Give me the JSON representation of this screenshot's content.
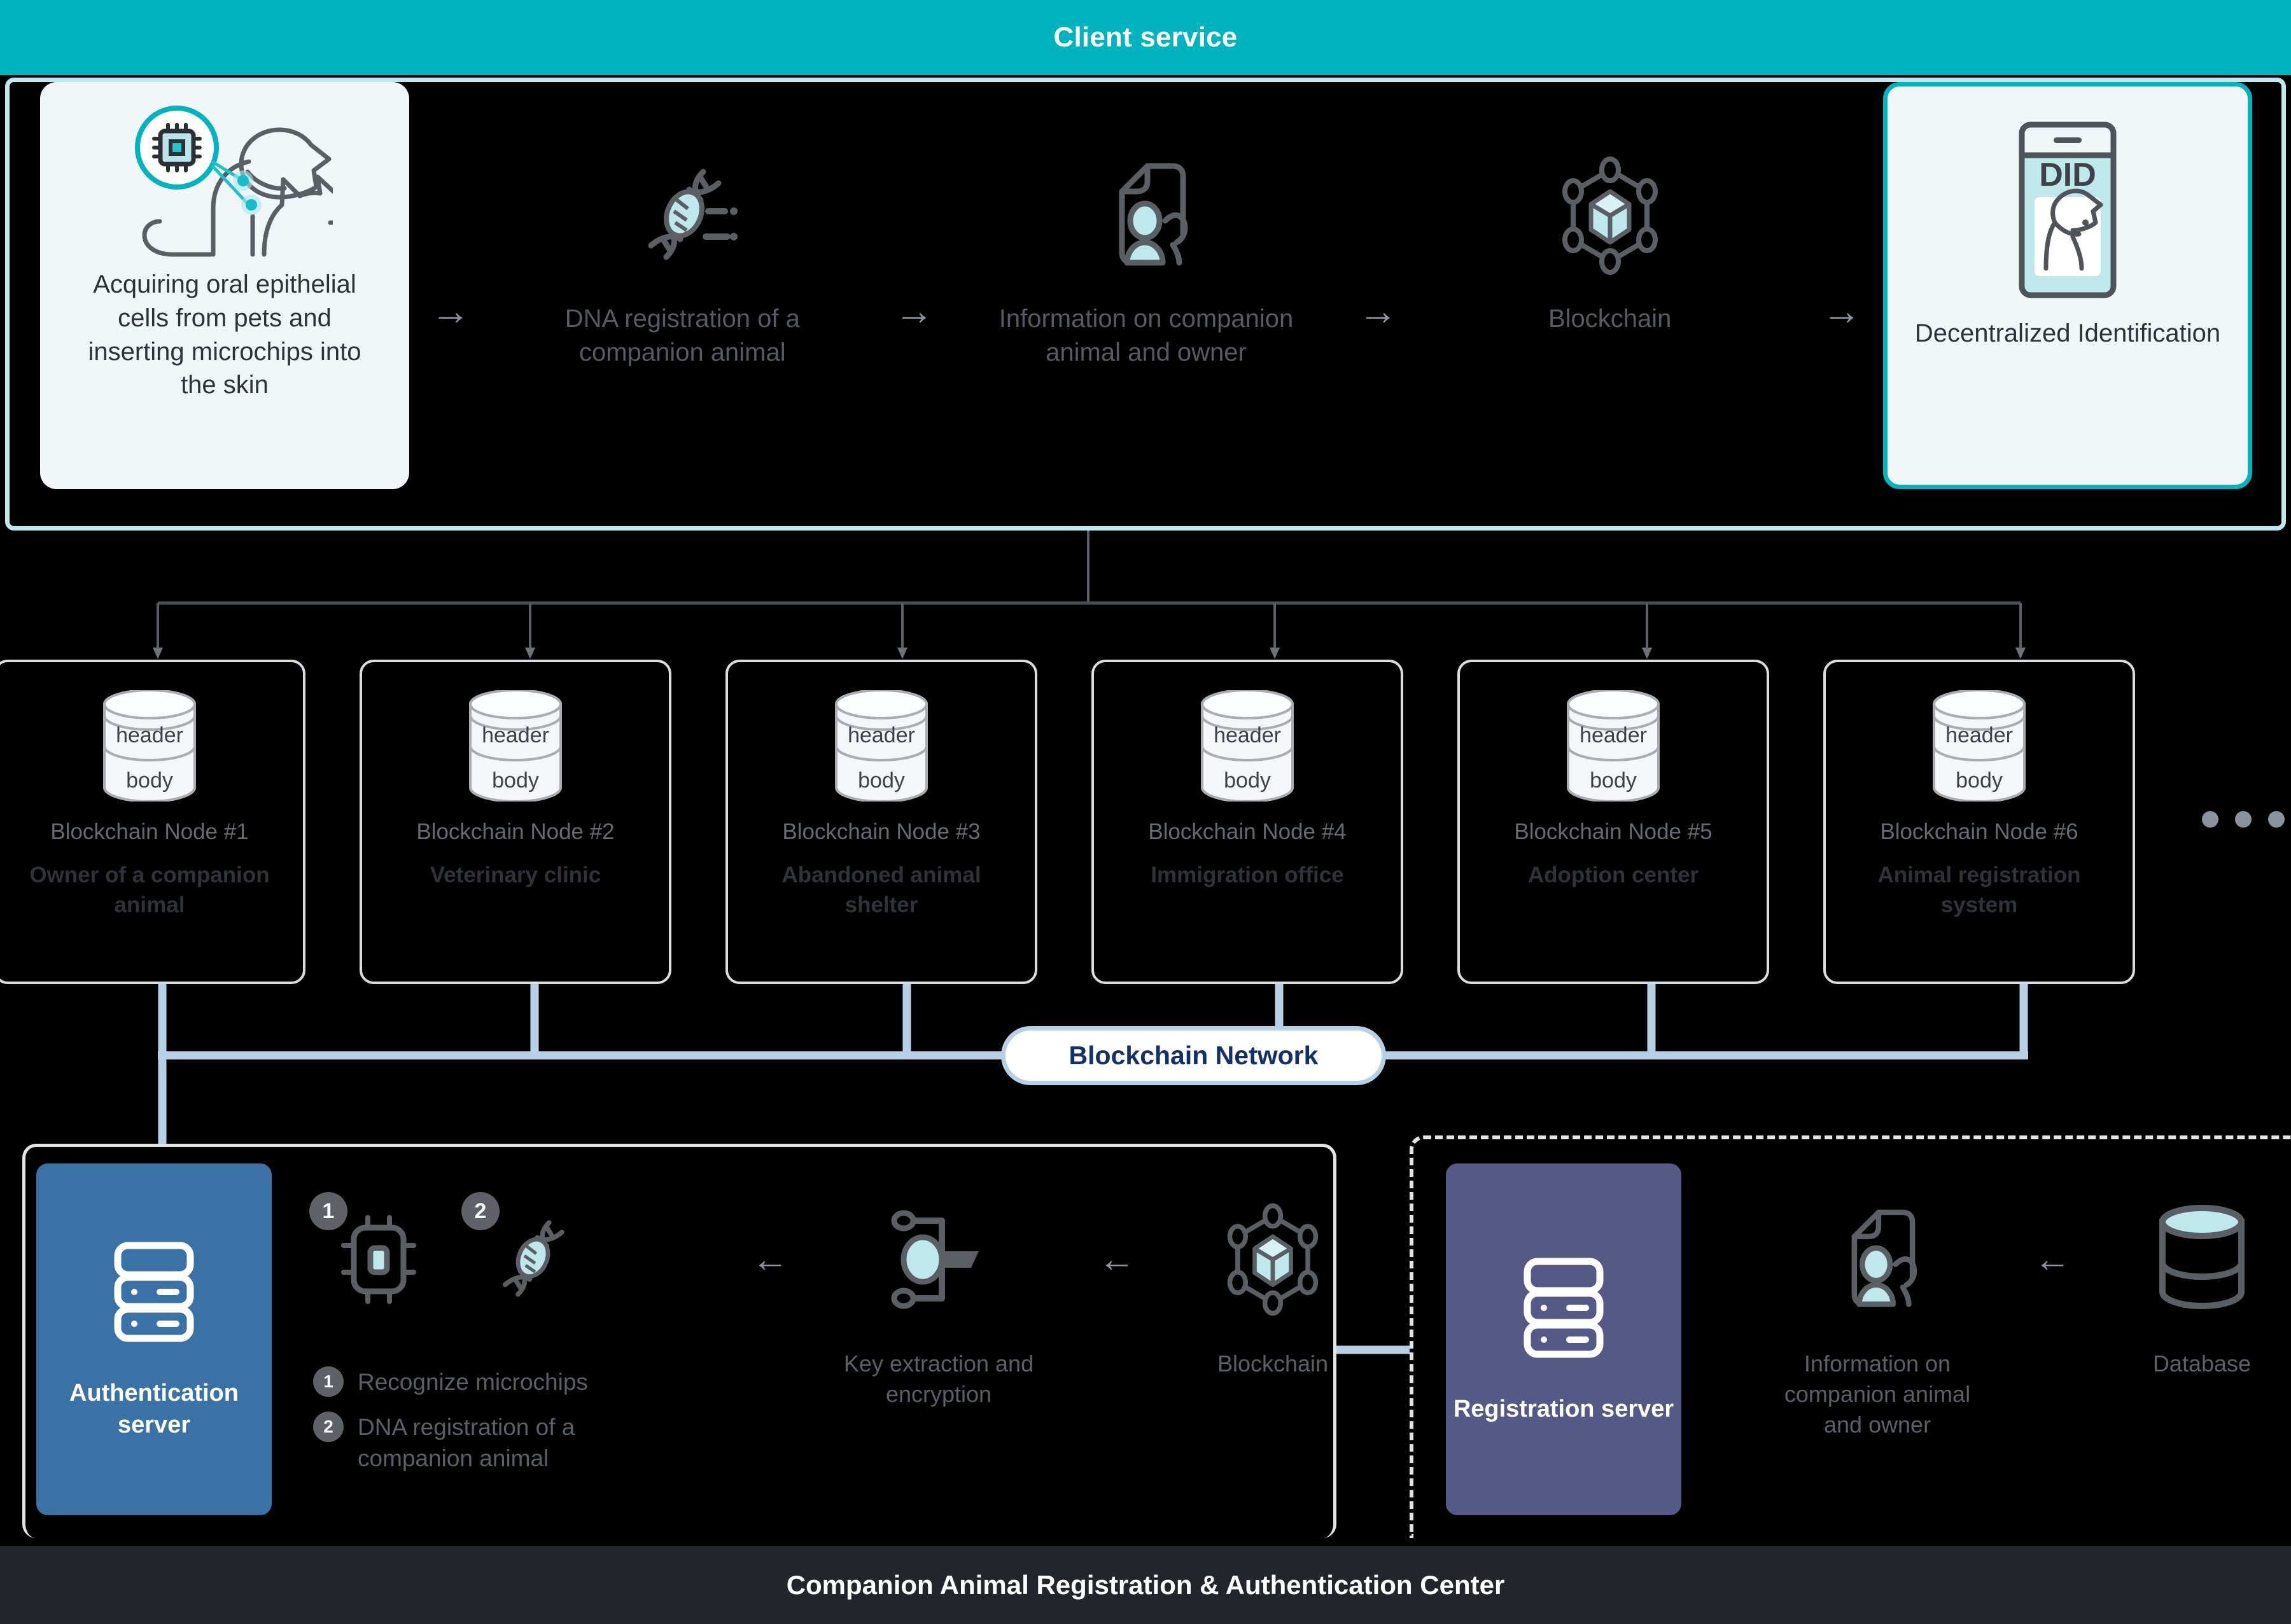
{
  "header": {
    "title": "Client service"
  },
  "top_flow": {
    "start_card": {
      "caption": "Acquiring oral epithelial cells from pets and inserting microchips into the skin",
      "icon": "pet-microchip-icon"
    },
    "steps": [
      {
        "caption": "DNA registration of a companion animal",
        "icon": "dna-icon"
      },
      {
        "caption": "Information on companion animal and owner",
        "icon": "document-person-pet-icon"
      },
      {
        "caption": "Blockchain",
        "icon": "blockchain-node-icon"
      }
    ],
    "end_card": {
      "badge": "DID",
      "caption": "Decentralized Identification",
      "icon": "did-phone-dog-icon"
    },
    "arrow_glyph": "→"
  },
  "nodes": {
    "block_header_label": "header",
    "block_body_label": "body",
    "items": [
      {
        "id": "Blockchain Node #1",
        "name": "Owner of a companion animal"
      },
      {
        "id": "Blockchain Node #2",
        "name": "Veterinary clinic"
      },
      {
        "id": "Blockchain Node #3",
        "name": "Abandoned animal shelter"
      },
      {
        "id": "Blockchain Node #4",
        "name": "Immigration office"
      },
      {
        "id": "Blockchain Node #5",
        "name": "Adoption center"
      },
      {
        "id": "Blockchain Node #6",
        "name": "Animal registration system"
      }
    ],
    "overflow_indicator": "• • •"
  },
  "network_pill": {
    "label": "Blockchain Network"
  },
  "auth_section": {
    "server_label": "Authentication server",
    "server_icon": "server-icon",
    "icons": [
      {
        "badge": "1",
        "icon": "microchip-icon"
      },
      {
        "badge": "2",
        "icon": "dna-icon"
      }
    ],
    "legend": [
      {
        "num": "1",
        "text": "Recognize microchips"
      },
      {
        "num": "2",
        "text": "DNA registration of a companion animal"
      }
    ],
    "steps": [
      {
        "caption": "Key extraction and encryption",
        "icon": "key-encryption-icon"
      },
      {
        "caption": "Blockchain",
        "icon": "blockchain-node-icon"
      }
    ],
    "arrow_glyph": "←"
  },
  "reg_section": {
    "server_label": "Registration server",
    "server_icon": "server-icon",
    "steps": [
      {
        "caption": "Information on companion animal and owner",
        "icon": "document-person-pet-icon"
      },
      {
        "caption": "Database",
        "icon": "database-icon"
      }
    ],
    "arrow_glyph": "←"
  },
  "footer": {
    "title": "Companion Animal Registration & Authentication Center"
  },
  "colors": {
    "accent_teal": "#00b4bf",
    "panel_border": "#bfe9ee",
    "card_bg": "#f1f6f9",
    "icon_fill": "#bfe7ec",
    "icon_stroke": "#555b63",
    "wire_blue": "#b8d0e6",
    "auth_server": "#3b72a6",
    "reg_server": "#545a85",
    "footer_bg": "#22262c"
  }
}
